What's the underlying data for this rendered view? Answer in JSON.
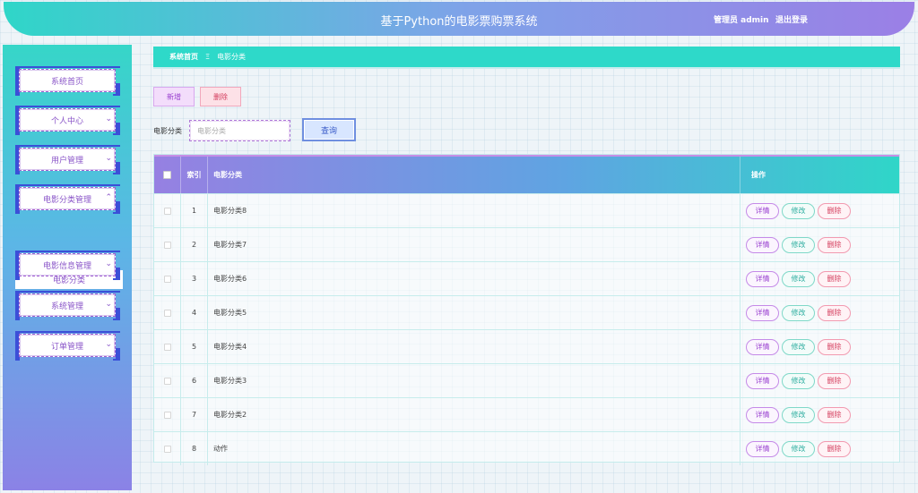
{
  "header": {
    "title": "基于Python的电影票购票系统",
    "user": "管理员 admin",
    "logout": "退出登录"
  },
  "sidebar": {
    "items": [
      {
        "label": "系统首页",
        "chevron": ""
      },
      {
        "label": "个人中心",
        "chevron": "⌄"
      },
      {
        "label": "用户管理",
        "chevron": "⌄"
      },
      {
        "label": "电影分类管理",
        "chevron": "⌃"
      },
      {
        "label": "电影信息管理",
        "chevron": "⌄"
      },
      {
        "label": "系统管理",
        "chevron": "⌄"
      },
      {
        "label": "订单管理",
        "chevron": "⌄"
      }
    ],
    "submenu_active": "电影分类"
  },
  "breadcrumb": {
    "home": "系统首页",
    "separator": "Ξ",
    "current": "电影分类"
  },
  "toolbar": {
    "add_label": "新增",
    "delete_label": "删除"
  },
  "search": {
    "label": "电影分类",
    "placeholder": "电影分类",
    "button": "查询"
  },
  "table": {
    "headers": {
      "index": "索引",
      "name": "电影分类",
      "ops": "操作"
    },
    "rows": [
      {
        "index": "1",
        "name": "电影分类8"
      },
      {
        "index": "2",
        "name": "电影分类7"
      },
      {
        "index": "3",
        "name": "电影分类6"
      },
      {
        "index": "4",
        "name": "电影分类5"
      },
      {
        "index": "5",
        "name": "电影分类4"
      },
      {
        "index": "6",
        "name": "电影分类3"
      },
      {
        "index": "7",
        "name": "电影分类2"
      },
      {
        "index": "8",
        "name": "动作"
      }
    ],
    "actions": {
      "detail": "详情",
      "edit": "修改",
      "delete": "删除"
    }
  },
  "colors": {
    "accent_teal": "#2ed9c9",
    "accent_purple": "#9680e2",
    "accent_blue": "#3b4fd8"
  }
}
